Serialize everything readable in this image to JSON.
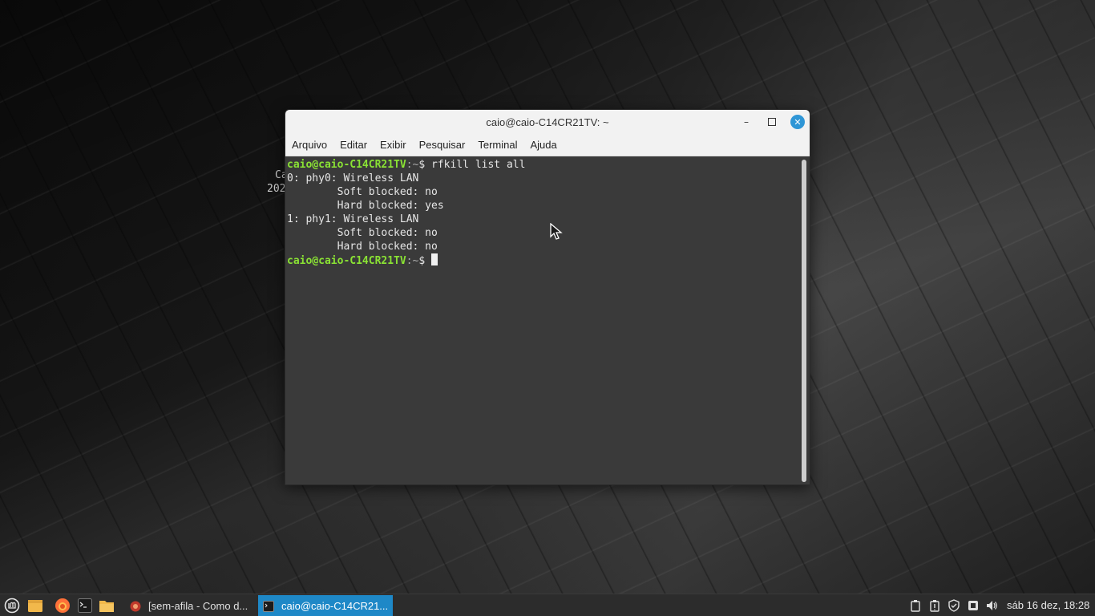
{
  "desktop": {
    "behind_text_1": "Ca",
    "behind_text_2": "202"
  },
  "window": {
    "title": "caio@caio-C14CR21TV: ~",
    "minimize_label": "–",
    "maximize_label": "☐",
    "close_label": "✕",
    "menu": [
      "Arquivo",
      "Editar",
      "Exibir",
      "Pesquisar",
      "Terminal",
      "Ajuda"
    ]
  },
  "terminal": {
    "prompt_user": "caio@caio-C14CR21TV",
    "prompt_path": ":~",
    "prompt_symbol": "$ ",
    "command": "rfkill list all",
    "output": [
      "0: phy0: Wireless LAN",
      "        Soft blocked: no",
      "        Hard blocked: yes",
      "1: phy1: Wireless LAN",
      "        Soft blocked: no",
      "        Hard blocked: no"
    ]
  },
  "taskbar": {
    "tasks": [
      {
        "label": "[sem-afila - Como d...",
        "active": false
      },
      {
        "label": "caio@caio-C14CR21...",
        "active": true
      }
    ],
    "clock": "sáb 16 dez, 18:28"
  },
  "colors": {
    "prompt": "#8ae234",
    "active_task": "#1e88c7",
    "close_button": "#2f96d6"
  }
}
